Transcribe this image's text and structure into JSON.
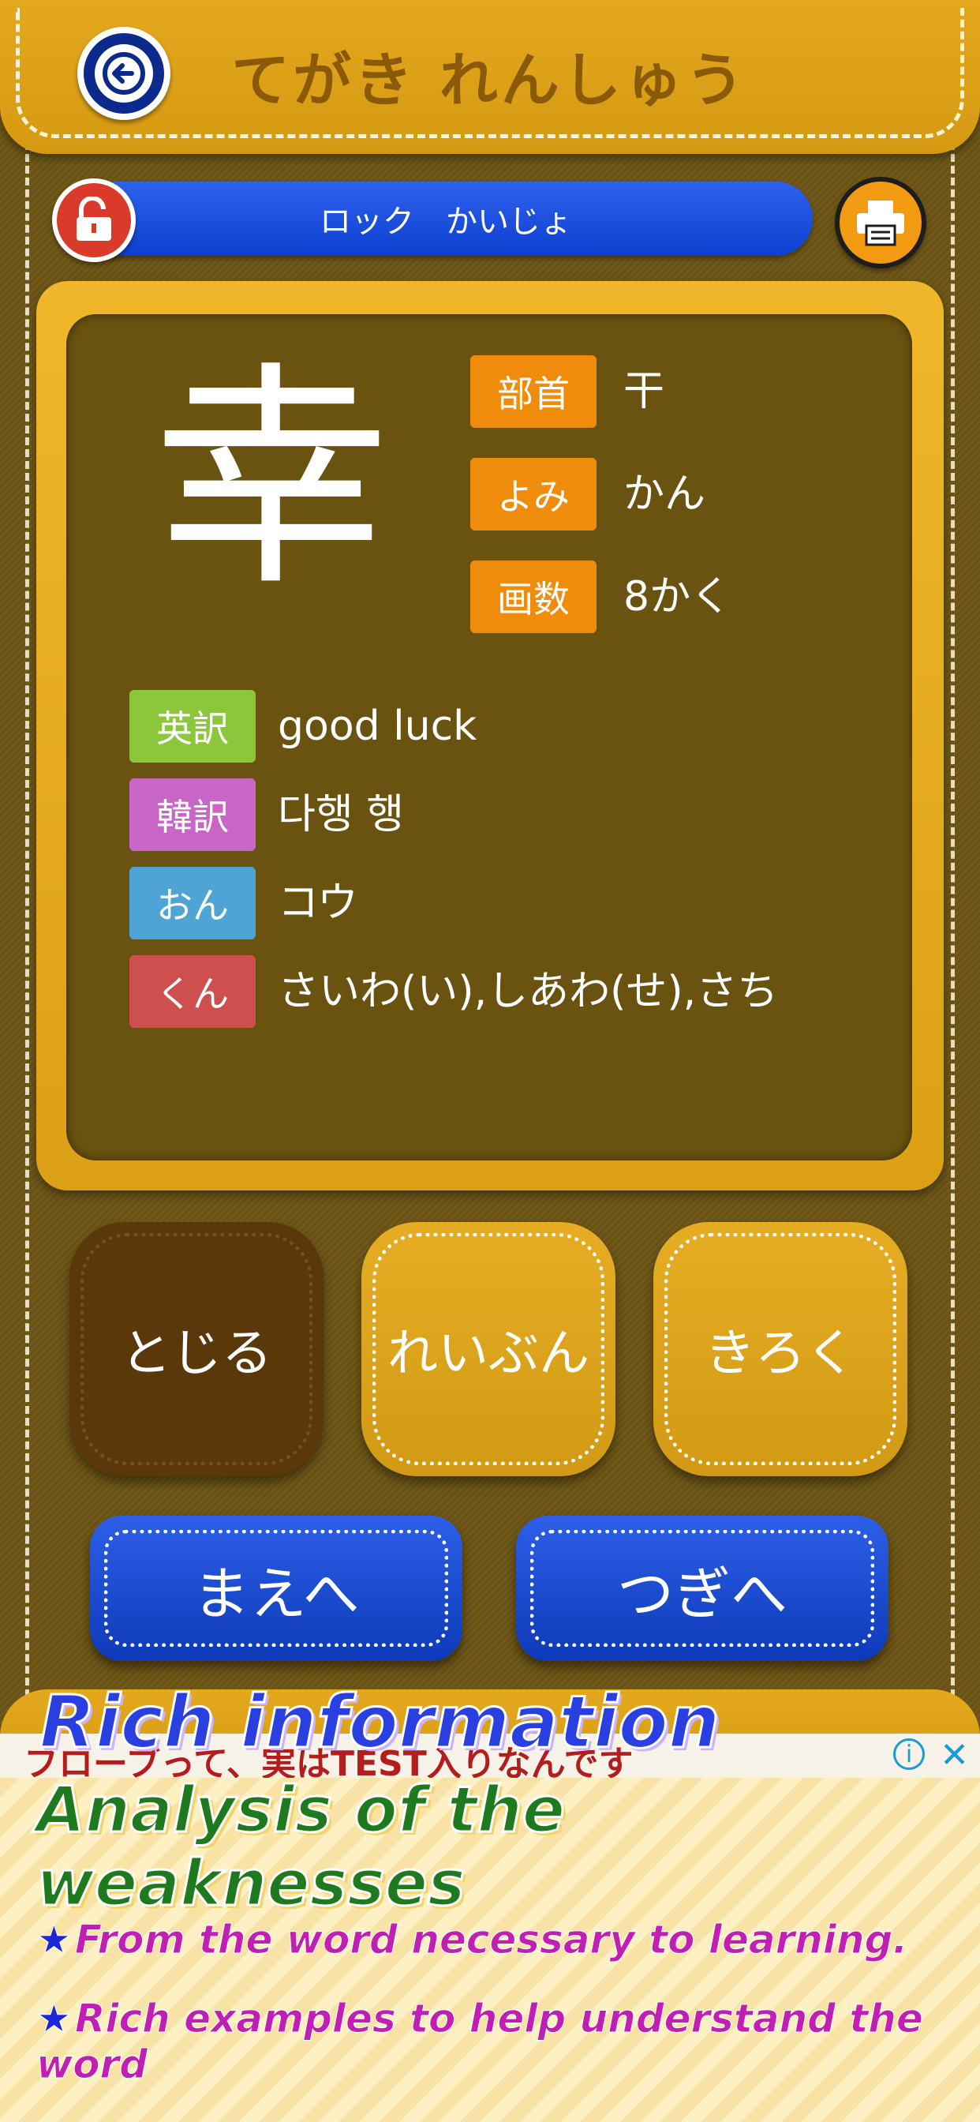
{
  "header": {
    "title": "てがき れんしゅう"
  },
  "lock_bar": {
    "label": "ロック　かいじょ"
  },
  "kanji": {
    "character": "幸",
    "bushu": {
      "tag": "部首",
      "value": "干"
    },
    "yomi": {
      "tag": "よみ",
      "value": "かん"
    },
    "kakusu": {
      "tag": "画数",
      "value": "8かく"
    },
    "eiyaku": {
      "tag": "英訳",
      "value": "good luck"
    },
    "kanyaku": {
      "tag": "韓訳",
      "value": "다행 행"
    },
    "on": {
      "tag": "おん",
      "value": "コウ"
    },
    "kun": {
      "tag": "くん",
      "value": "さいわ(い),しあわ(せ),さち"
    }
  },
  "buttons": {
    "close": "とじる",
    "example": "れいぶん",
    "record": "きろく"
  },
  "nav": {
    "prev": "まえへ",
    "next": "つぎへ"
  },
  "ad": {
    "text": "フローブって、実はTEST入りなんです"
  },
  "promo": {
    "title1": "Rich information",
    "title2": "Analysis of the weaknesses",
    "line1": "From the word necessary to learning.",
    "line2": "Rich examples to help understand the word",
    "star": "★"
  },
  "colors": {
    "background": "#6b5414",
    "gold": "#e4a81f",
    "blue": "#0d3fd0",
    "tag_orange": "#f08c0c",
    "tag_green": "#8cc63a",
    "tag_pink": "#c965c7",
    "tag_blue": "#4fa4d6",
    "tag_red": "#cf4f4f"
  }
}
